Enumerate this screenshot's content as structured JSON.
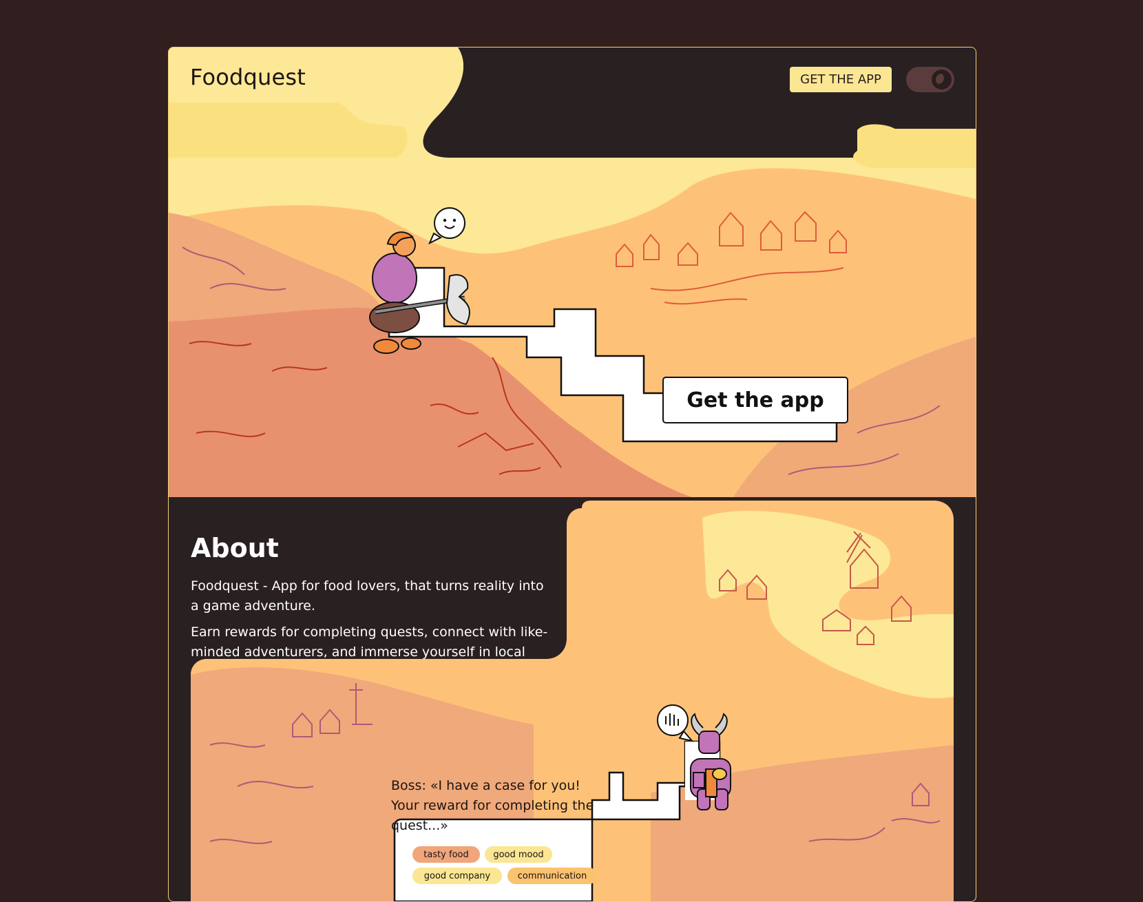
{
  "header": {
    "logo": "Foodquest",
    "get_app_label": "GET THE APP",
    "theme_toggle_icon": "moon-icon"
  },
  "hero": {
    "cta_label": "Get the app",
    "speech_icon": "smiley-icon"
  },
  "about": {
    "title": "About",
    "paragraph1": "Foodquest - App for food lovers, that turns reality into a game adventure.",
    "paragraph2": "Earn rewards for completing quests, connect with like-minded adventurers, and immerse yourself in local cultures!"
  },
  "quest": {
    "dialog": "Boss: «I have a case for you! Your reward for completing the quest...»",
    "speech_icon": "waving-hand-icon",
    "tags": [
      "tasty food",
      "good mood",
      "good company",
      "communication"
    ]
  },
  "colors": {
    "background": "#311f20",
    "card": "#292022",
    "sky": "#fce896",
    "accent_button": "#fbe693",
    "tag_orange": "#f0a57a",
    "tag_yellow": "#fbe693",
    "tag_peach": "#fbc26f"
  }
}
